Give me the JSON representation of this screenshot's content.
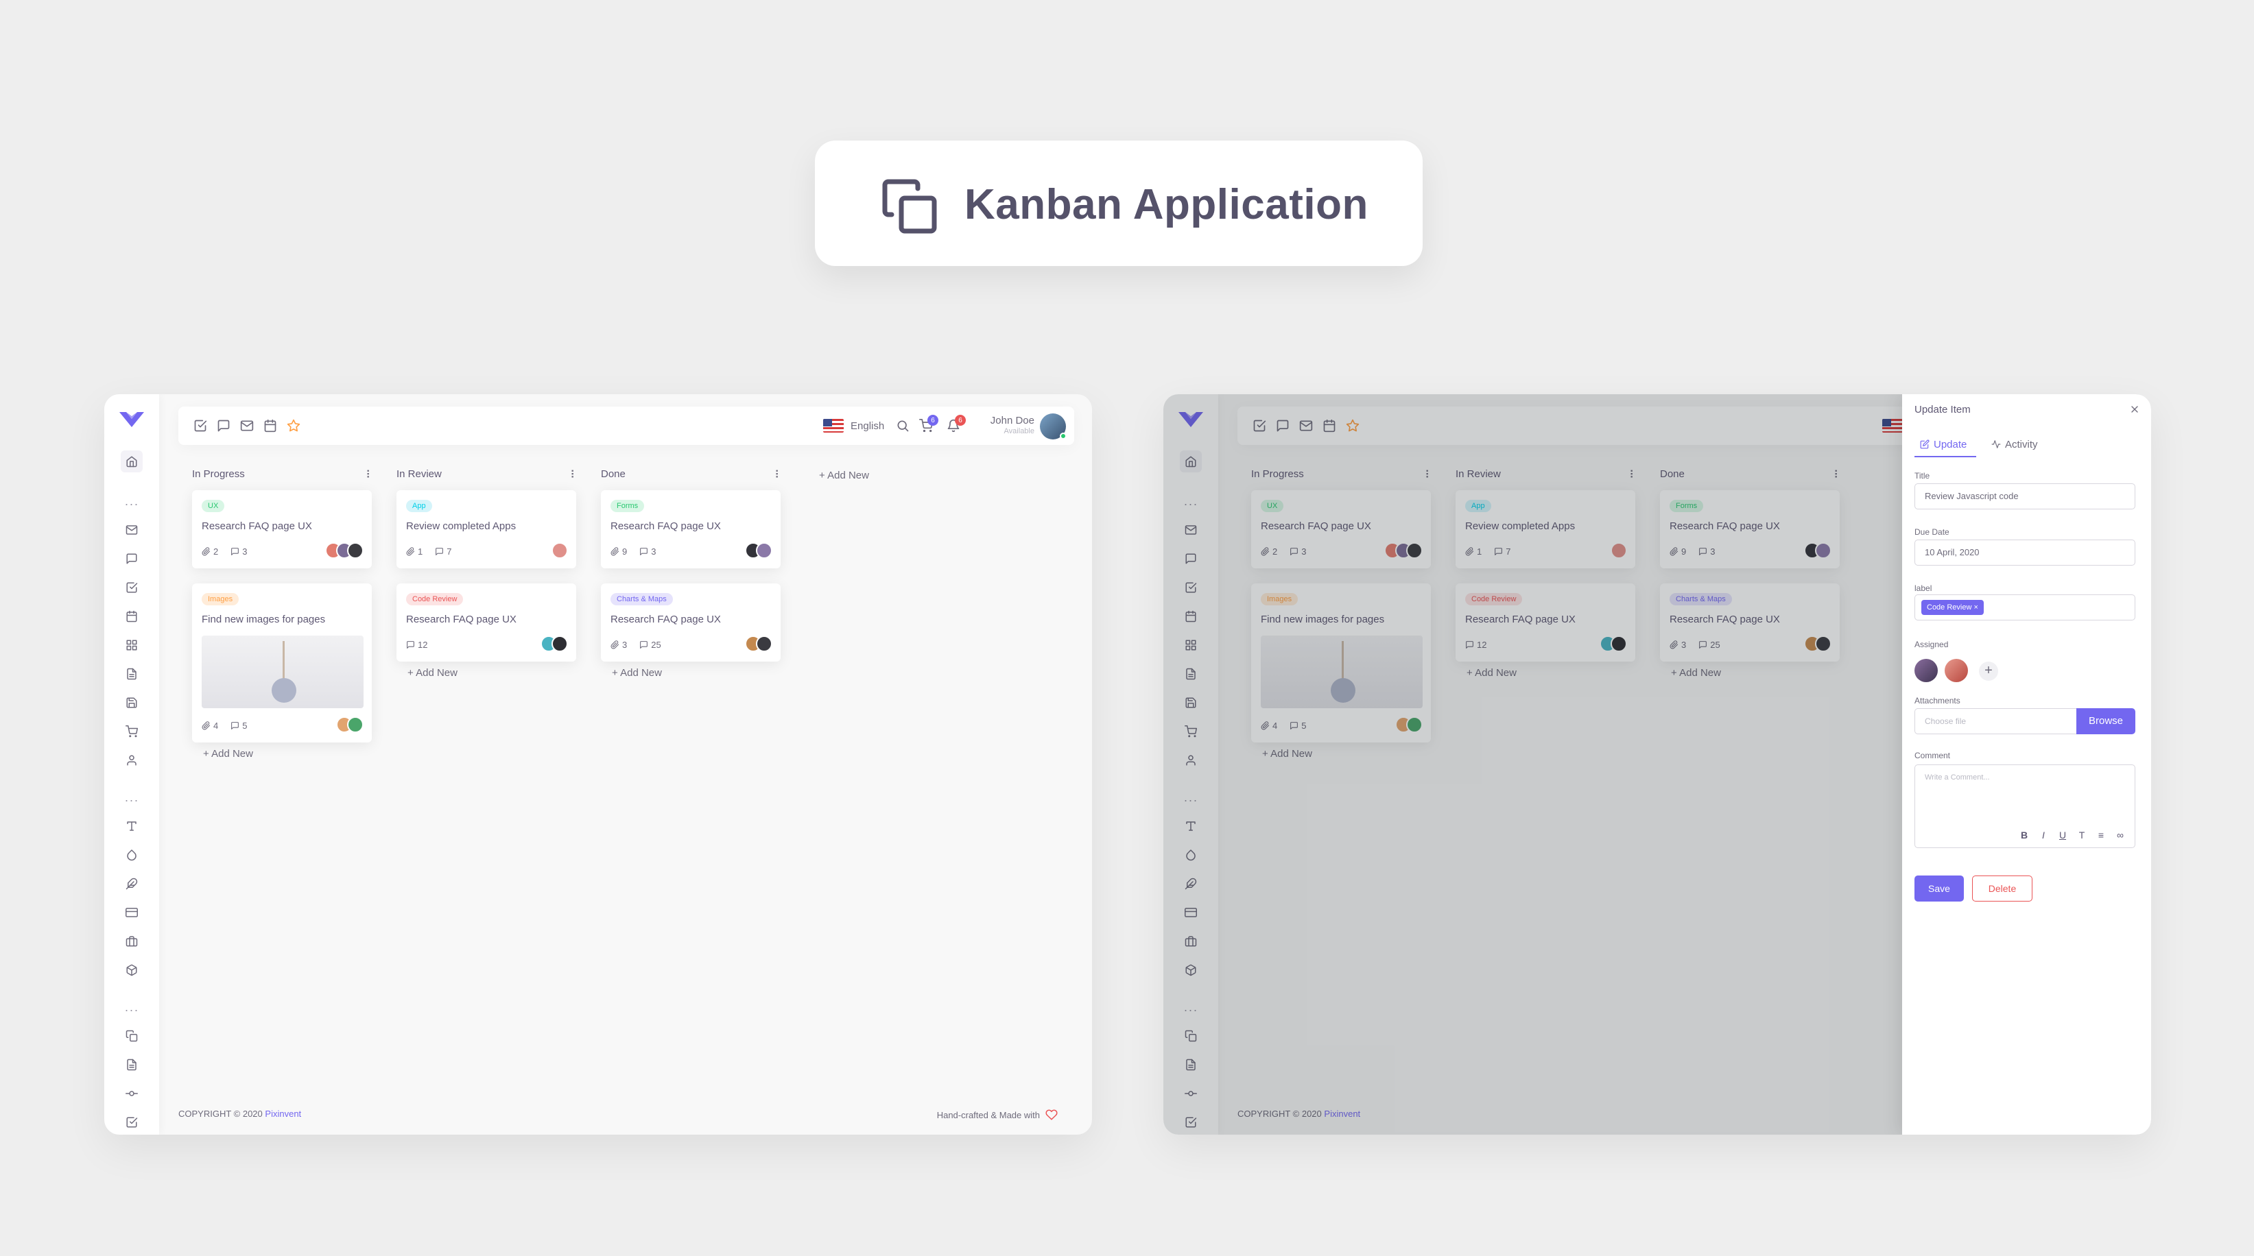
{
  "banner": {
    "title": "Kanban Application",
    "icon": "copy-icon"
  },
  "colors": {
    "primary": "#7367f0",
    "success": "#28c76f",
    "info": "#00cfe8",
    "warning": "#ff9f43",
    "danger": "#ea5455"
  },
  "navbar": {
    "language": "English",
    "cart_count": "6",
    "notification_count": "6",
    "user_name": "John Doe",
    "user_status": "Available"
  },
  "columns": [
    {
      "title": "In Progress",
      "add_label": "+ Add New",
      "cards": [
        {
          "tag": "UX",
          "title": "Research FAQ page UX",
          "attachments": "2",
          "comments": "3"
        },
        {
          "tag": "Images",
          "title": "Find new images for pages",
          "attachments": "4",
          "comments": "5"
        }
      ]
    },
    {
      "title": "In Review",
      "add_label": "+ Add New",
      "cards": [
        {
          "tag": "App",
          "title": "Review completed Apps",
          "attachments": "1",
          "comments": "7"
        },
        {
          "tag": "Code Review",
          "title": "Research FAQ page UX",
          "comments": "12"
        }
      ]
    },
    {
      "title": "Done",
      "add_label": "+ Add New",
      "cards": [
        {
          "tag": "Forms",
          "title": "Research FAQ page UX",
          "attachments": "9",
          "comments": "3"
        },
        {
          "tag": "Charts & Maps",
          "title": "Research FAQ page UX",
          "attachments": "3",
          "comments": "25"
        }
      ]
    }
  ],
  "add_board_label": "+ Add New",
  "footer": {
    "copyright": "COPYRIGHT © 2020",
    "brand": "Pixinvent",
    "made_with": "Hand-crafted & Made with"
  },
  "panel": {
    "title": "Update Item",
    "tab_update": "Update",
    "tab_activity": "Activity",
    "title_label": "Title",
    "title_value": "Review Javascript code",
    "due_label": "Due Date",
    "due_value": "10 April, 2020",
    "label_label": "label",
    "chip": "Code Review ×",
    "assigned_label": "Assigned",
    "add_assignee": "+",
    "attachments_label": "Attachments",
    "file_placeholder": "Choose file",
    "browse": "Browse",
    "comment_label": "Comment",
    "comment_placeholder": "Write a Comment...",
    "toolbar": [
      "B",
      "I",
      "U",
      "T",
      "≡",
      "∞"
    ],
    "save": "Save",
    "delete": "Delete"
  }
}
